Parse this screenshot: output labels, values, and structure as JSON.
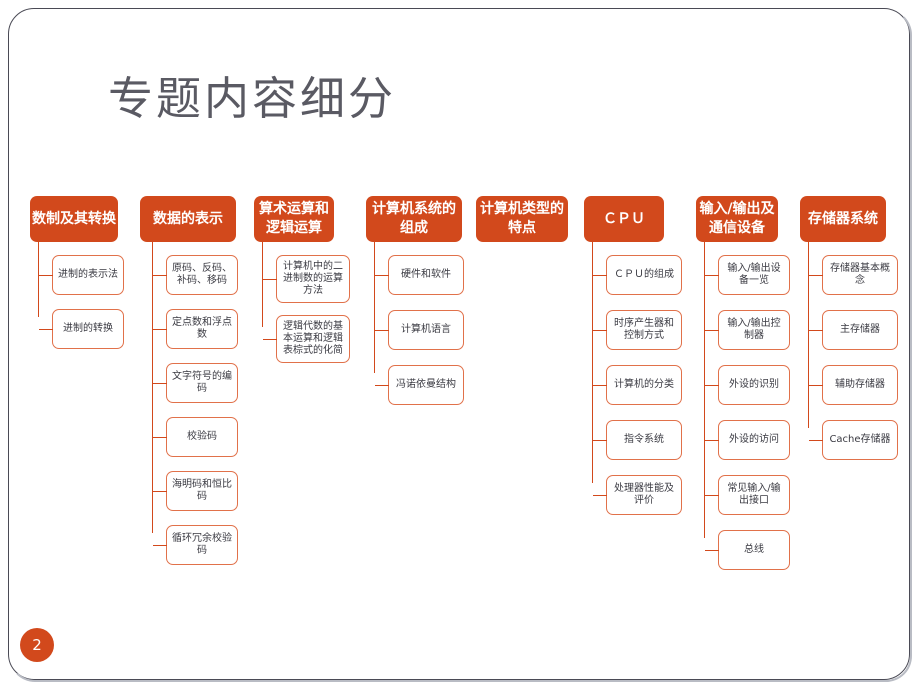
{
  "slide": {
    "title": "专题内容细分",
    "page_number": "2",
    "accent_color": "#d2491c",
    "child_border_color": "#e1714a",
    "title_color": "#5a5a63",
    "frame_color": "#4a4a55"
  },
  "chart_data": {
    "type": "diagram",
    "title": "专题内容细分",
    "layout": "horizontal tree columns, each root heading with vertical connector to child boxes",
    "columns": [
      {
        "header": "数制及其转换",
        "children": [
          "进制的表示法",
          "进制的转换"
        ]
      },
      {
        "header": "数据的表示",
        "children": [
          "原码、反码、补码、移码",
          "定点数和浮点数",
          "文字符号的编码",
          "校验码",
          "海明码和恒比码",
          "循环冗余校验码"
        ]
      },
      {
        "header": "算术运算和逻辑运算",
        "children": [
          "计算机中的二进制数的运算方法",
          "逻辑代数的基本运算和逻辑表棕式的化简"
        ]
      },
      {
        "header": "计算机系统的组成",
        "children": [
          "硬件和软件",
          "计算机语言",
          "冯诺依曼结构"
        ]
      },
      {
        "header": "计算机类型的特点",
        "children": []
      },
      {
        "header": "ＣＰＵ",
        "children": [
          "ＣＰＵ的组成",
          "时序产生器和控制方式",
          "计算机的分类",
          "指令系统",
          "处理器性能及评价"
        ]
      },
      {
        "header": "输入/输出及通信设备",
        "children": [
          "输入/输出设备一览",
          "输入/输出控制器",
          "外设的识别",
          "外设的访问",
          "常见输入/输出接口",
          "总线"
        ]
      },
      {
        "header": "存储器系统",
        "children": [
          "存储器基本概念",
          "主存储器",
          "辅助存储器",
          "Cache存储器"
        ]
      }
    ]
  }
}
